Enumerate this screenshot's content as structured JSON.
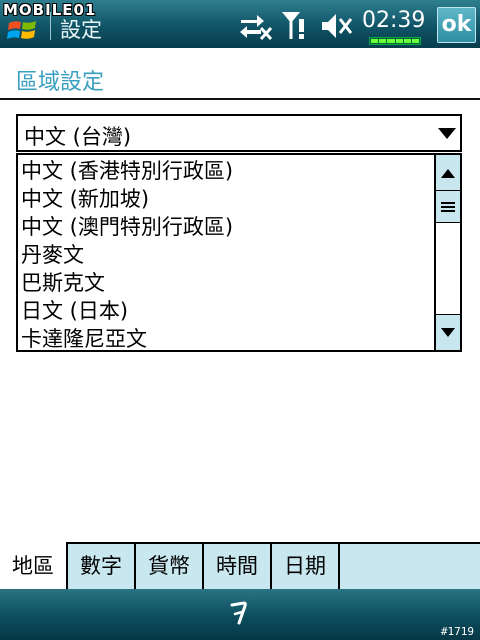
{
  "status_bar": {
    "watermark": "MOBILE01",
    "app_title": "設定",
    "clock": "02:39",
    "ok_label": "ok",
    "battery_level": 1.0
  },
  "page": {
    "heading": "區域設定"
  },
  "region_select": {
    "selected": "中文 (台灣)",
    "options": [
      "中文 (香港特別行政區)",
      "中文 (新加坡)",
      "中文 (澳門特別行政區)",
      "丹麥文",
      "巴斯克文",
      "日文 (日本)",
      "卡達隆尼亞文"
    ]
  },
  "tabs": [
    {
      "label": "地區",
      "active": true
    },
    {
      "label": "數字",
      "active": false
    },
    {
      "label": "貨幣",
      "active": false
    },
    {
      "label": "時間",
      "active": false
    },
    {
      "label": "日期",
      "active": false
    }
  ],
  "footer": {
    "image_number": "#1719"
  },
  "icons": {
    "start": "windows-flag-icon",
    "sync": "sync-disconnected-icon",
    "signal": "signal-icon",
    "volume": "volume-muted-icon",
    "scroll_up": "triangle-up-icon",
    "scroll_down": "triangle-down-icon",
    "dropdown": "triangle-down-icon",
    "keyboard": "input-panel-icon"
  },
  "colors": {
    "accent": "#3aa0c0",
    "bar_dark": "#0f5466",
    "tab_bg": "#c9e7ef",
    "scroll_bg": "#c8e6ee"
  }
}
